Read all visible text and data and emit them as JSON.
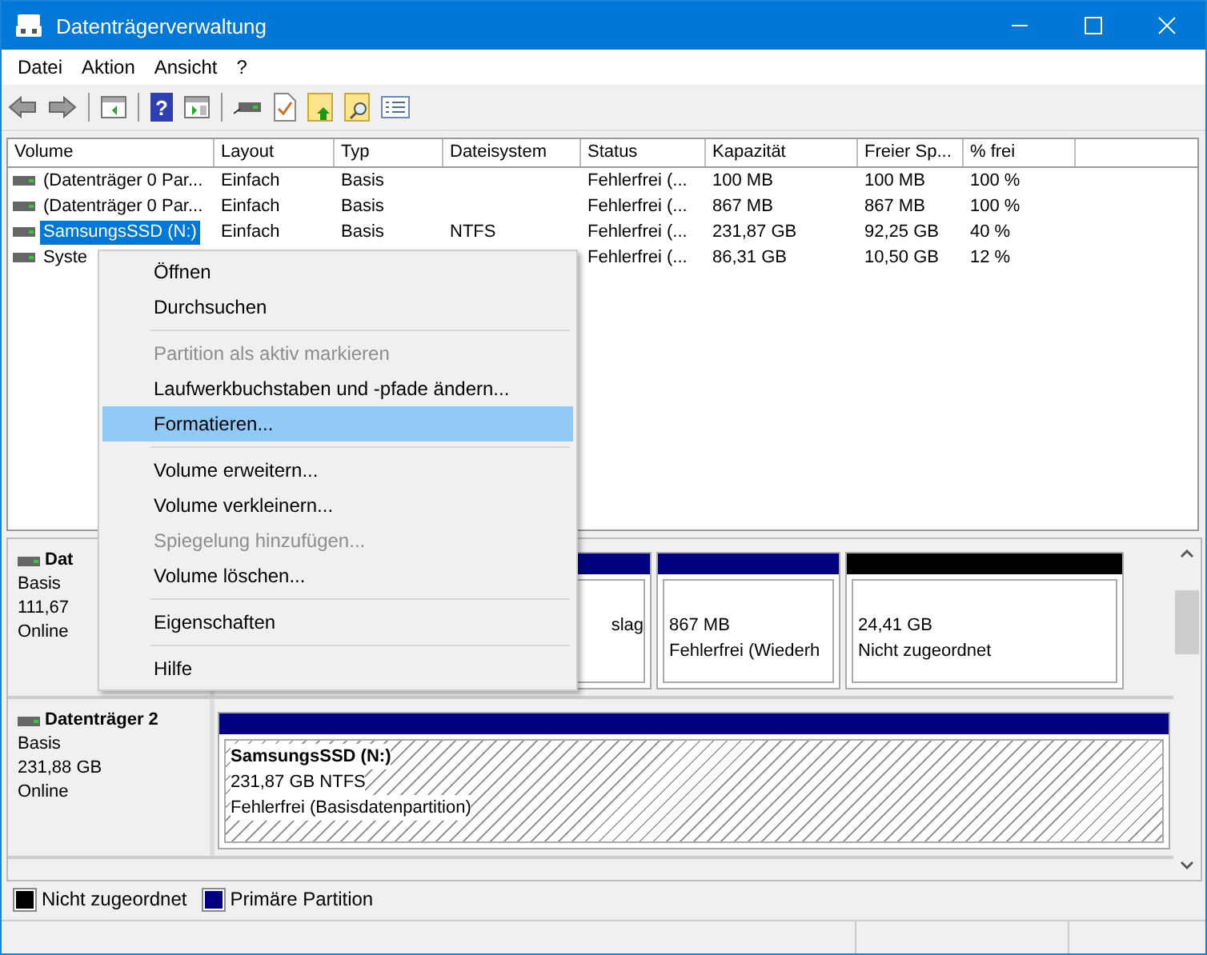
{
  "window": {
    "title": "Datenträgerverwaltung"
  },
  "toolbar": {
    "help_glyph": "?"
  },
  "menu_bar": [
    {
      "label": "Datei"
    },
    {
      "label": "Aktion"
    },
    {
      "label": "Ansicht"
    },
    {
      "label": "?"
    }
  ],
  "table": {
    "columns": [
      "Volume",
      "Layout",
      "Typ",
      "Dateisystem",
      "Status",
      "Kapazität",
      "Freier Sp...",
      "% frei"
    ],
    "rows": [
      {
        "selected": false,
        "cells": [
          "(Datenträger 0 Par...",
          "Einfach",
          "Basis",
          null,
          "Fehlerfrei (...",
          "100 MB",
          "100 MB",
          "100 %"
        ]
      },
      {
        "selected": false,
        "cells": [
          "(Datenträger 0 Par...",
          "Einfach",
          "Basis",
          null,
          "Fehlerfrei (...",
          "867 MB",
          "867 MB",
          "100 %"
        ]
      },
      {
        "selected": true,
        "cells": [
          "SamsungsSSD (N:)",
          "Einfach",
          "Basis",
          "NTFS",
          "Fehlerfrei (...",
          "231,87 GB",
          "92,25 GB",
          "40 %"
        ]
      },
      {
        "selected": false,
        "cells": [
          "Syste",
          null,
          null,
          null,
          "Fehlerfrei (...",
          "86,31 GB",
          "10,50 GB",
          "12 %"
        ]
      }
    ]
  },
  "disks": [
    {
      "name": "Dat",
      "disk_type": "Basis",
      "size": "111,67",
      "status": "Online",
      "partitions": [
        {
          "color": "#000080",
          "hatched": false,
          "lines": [
            "slag"
          ]
        },
        {
          "color": "#000080",
          "hatched": false,
          "lines": [
            "867 MB",
            "Fehlerfrei (Wiederh"
          ]
        },
        {
          "color": "#000000",
          "hatched": false,
          "lines": [
            "24,41 GB",
            "Nicht zugeordnet"
          ]
        }
      ]
    },
    {
      "name": "Datenträger 2",
      "disk_type": "Basis",
      "size": "231,88 GB",
      "status": "Online",
      "partitions": [
        {
          "color": "#000080",
          "hatched": true,
          "title": "SamsungsSSD  (N:)",
          "lines": [
            "231,87 GB NTFS",
            "Fehlerfrei (Basisdatenpartition)"
          ]
        }
      ]
    }
  ],
  "legend": [
    {
      "label": "Nicht zugeordnet",
      "color": "#000000"
    },
    {
      "label": "Primäre Partition",
      "color": "#000080"
    }
  ],
  "context_menu": [
    {
      "kind": "item",
      "label": "Öffnen",
      "disabled": false,
      "selected": false
    },
    {
      "kind": "item",
      "label": "Durchsuchen",
      "disabled": false,
      "selected": false
    },
    {
      "kind": "separator"
    },
    {
      "kind": "item",
      "label": "Partition als aktiv markieren",
      "disabled": true,
      "selected": false
    },
    {
      "kind": "item",
      "label": "Laufwerkbuchstaben und -pfade ändern...",
      "disabled": false,
      "selected": false
    },
    {
      "kind": "item",
      "label": "Formatieren...",
      "disabled": false,
      "selected": true
    },
    {
      "kind": "separator"
    },
    {
      "kind": "item",
      "label": "Volume erweitern...",
      "disabled": false,
      "selected": false
    },
    {
      "kind": "item",
      "label": "Volume verkleinern...",
      "disabled": false,
      "selected": false
    },
    {
      "kind": "item",
      "label": "Spiegelung hinzufügen...",
      "disabled": true,
      "selected": false
    },
    {
      "kind": "item",
      "label": "Volume löschen...",
      "disabled": false,
      "selected": false
    },
    {
      "kind": "separator"
    },
    {
      "kind": "item",
      "label": "Eigenschaften",
      "disabled": false,
      "selected": false
    },
    {
      "kind": "separator"
    },
    {
      "kind": "item",
      "label": "Hilfe",
      "disabled": false,
      "selected": false
    }
  ]
}
